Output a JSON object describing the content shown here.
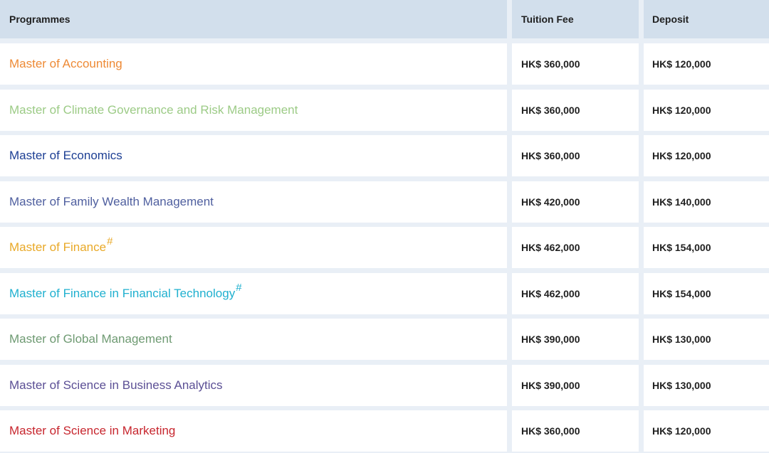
{
  "headers": {
    "programmes": "Programmes",
    "tuition": "Tuition Fee",
    "deposit": "Deposit"
  },
  "rows": [
    {
      "programme": "Master of Accounting",
      "mark": "",
      "tuition": "HK$ 360,000",
      "deposit": "HK$ 120,000",
      "color": "#ee8a35"
    },
    {
      "programme": "Master of Climate Governance and Risk Management",
      "mark": "",
      "tuition": "HK$ 360,000",
      "deposit": "HK$ 120,000",
      "color": "#9ccb86"
    },
    {
      "programme": "Master of Economics",
      "mark": "",
      "tuition": "HK$ 360,000",
      "deposit": "HK$ 120,000",
      "color": "#1d3f94"
    },
    {
      "programme": "Master of Family Wealth Management",
      "mark": "",
      "tuition": "HK$ 420,000",
      "deposit": "HK$ 140,000",
      "color": "#4f5f9f"
    },
    {
      "programme": "Master of Finance",
      "mark": "#",
      "tuition": "HK$ 462,000",
      "deposit": "HK$ 154,000",
      "color": "#e9a928"
    },
    {
      "programme": "Master of Finance in Financial Technology",
      "mark": "#",
      "tuition": "HK$ 462,000",
      "deposit": "HK$ 154,000",
      "color": "#1fb0cf"
    },
    {
      "programme": "Master of Global Management",
      "mark": "",
      "tuition": "HK$ 390,000",
      "deposit": "HK$ 130,000",
      "color": "#6e9a72"
    },
    {
      "programme": "Master of Science in Business Analytics",
      "mark": "",
      "tuition": "HK$ 390,000",
      "deposit": "HK$ 130,000",
      "color": "#5b4f95"
    },
    {
      "programme": "Master of Science in Marketing",
      "mark": "",
      "tuition": "HK$ 360,000",
      "deposit": "HK$ 120,000",
      "color": "#c7262e"
    }
  ]
}
